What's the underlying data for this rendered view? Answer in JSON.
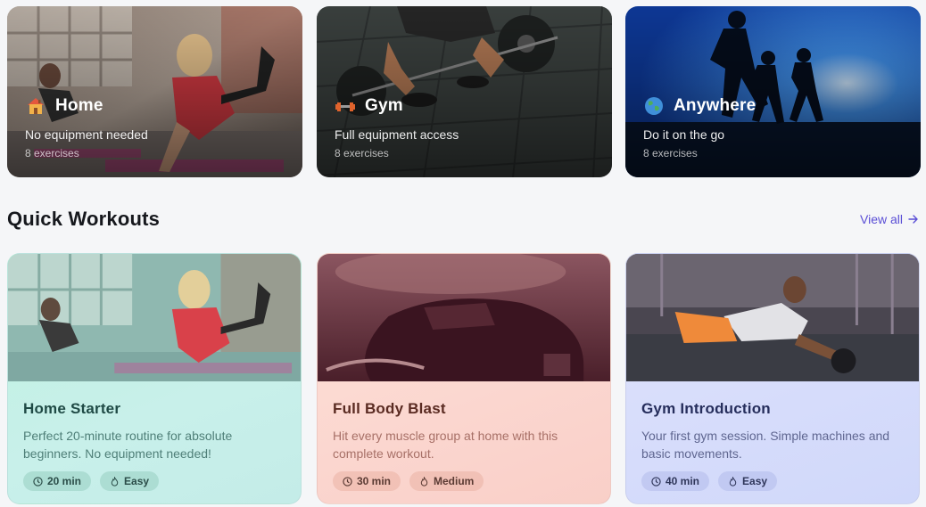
{
  "categories": [
    {
      "title": "Home",
      "subtitle": "No equipment needed",
      "count": "8 exercises",
      "icon": "house-icon"
    },
    {
      "title": "Gym",
      "subtitle": "Full equipment access",
      "count": "8 exercises",
      "icon": "dumbbell-icon"
    },
    {
      "title": "Anywhere",
      "subtitle": "Do it on the go",
      "count": "8 exercises",
      "icon": "globe-icon"
    }
  ],
  "section": {
    "title": "Quick Workouts",
    "view_all": "View all"
  },
  "workouts": [
    {
      "title": "Home Starter",
      "description": "Perfect 20-minute routine for absolute beginners. No equipment needed!",
      "duration": "20 min",
      "level": "Easy"
    },
    {
      "title": "Full Body Blast",
      "description": "Hit every muscle group at home with this complete workout.",
      "duration": "30 min",
      "level": "Medium"
    },
    {
      "title": "Gym Introduction",
      "description": "Your first gym session. Simple machines and basic movements.",
      "duration": "40 min",
      "level": "Easy"
    }
  ],
  "colors": {
    "accent": "#5b4fd6",
    "home_card": "#c4efe6",
    "blast_card": "#fbd8cf",
    "gym_card": "#d6dcfb"
  }
}
